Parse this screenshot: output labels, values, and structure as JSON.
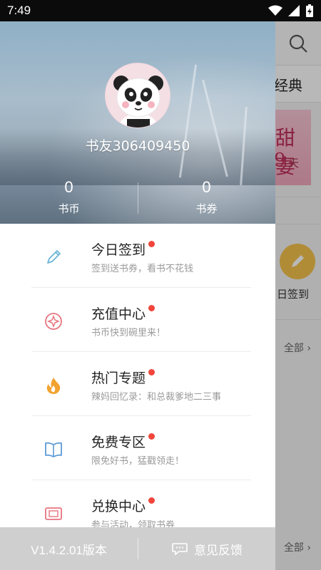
{
  "status_bar": {
    "time": "7:49"
  },
  "background": {
    "tab_label": "经典",
    "banner_line1": "甜妻",
    "banner_line2": "9",
    "banner_line3": "天",
    "sign_label": "日签到",
    "all_label_1": "全部 ›",
    "all_label_2": "全部 ›"
  },
  "drawer": {
    "username": "书友306409450",
    "stats": [
      {
        "value": "0",
        "label": "书币"
      },
      {
        "value": "0",
        "label": "书券"
      }
    ],
    "menu": [
      {
        "title": "今日签到",
        "subtitle": "签到送书券，看书不花钱",
        "icon": "pencil-icon",
        "color": "#6cb5d8"
      },
      {
        "title": "充值中心",
        "subtitle": "书币快到碗里来！",
        "icon": "coin-icon",
        "color": "#e8737e"
      },
      {
        "title": "热门专题",
        "subtitle": "辣妈回忆录：和总裁爹地二三事",
        "icon": "flame-icon",
        "color": "#f2a330"
      },
      {
        "title": "免费专区",
        "subtitle": "限免好书，猛戳领走！",
        "icon": "book-icon",
        "color": "#5b9ad6"
      },
      {
        "title": "兑换中心",
        "subtitle": "参与活动，领取书券",
        "icon": "ticket-icon",
        "color": "#e8737e"
      }
    ],
    "footer": {
      "version": "V1.4.2.01版本",
      "feedback": "意见反馈"
    }
  }
}
